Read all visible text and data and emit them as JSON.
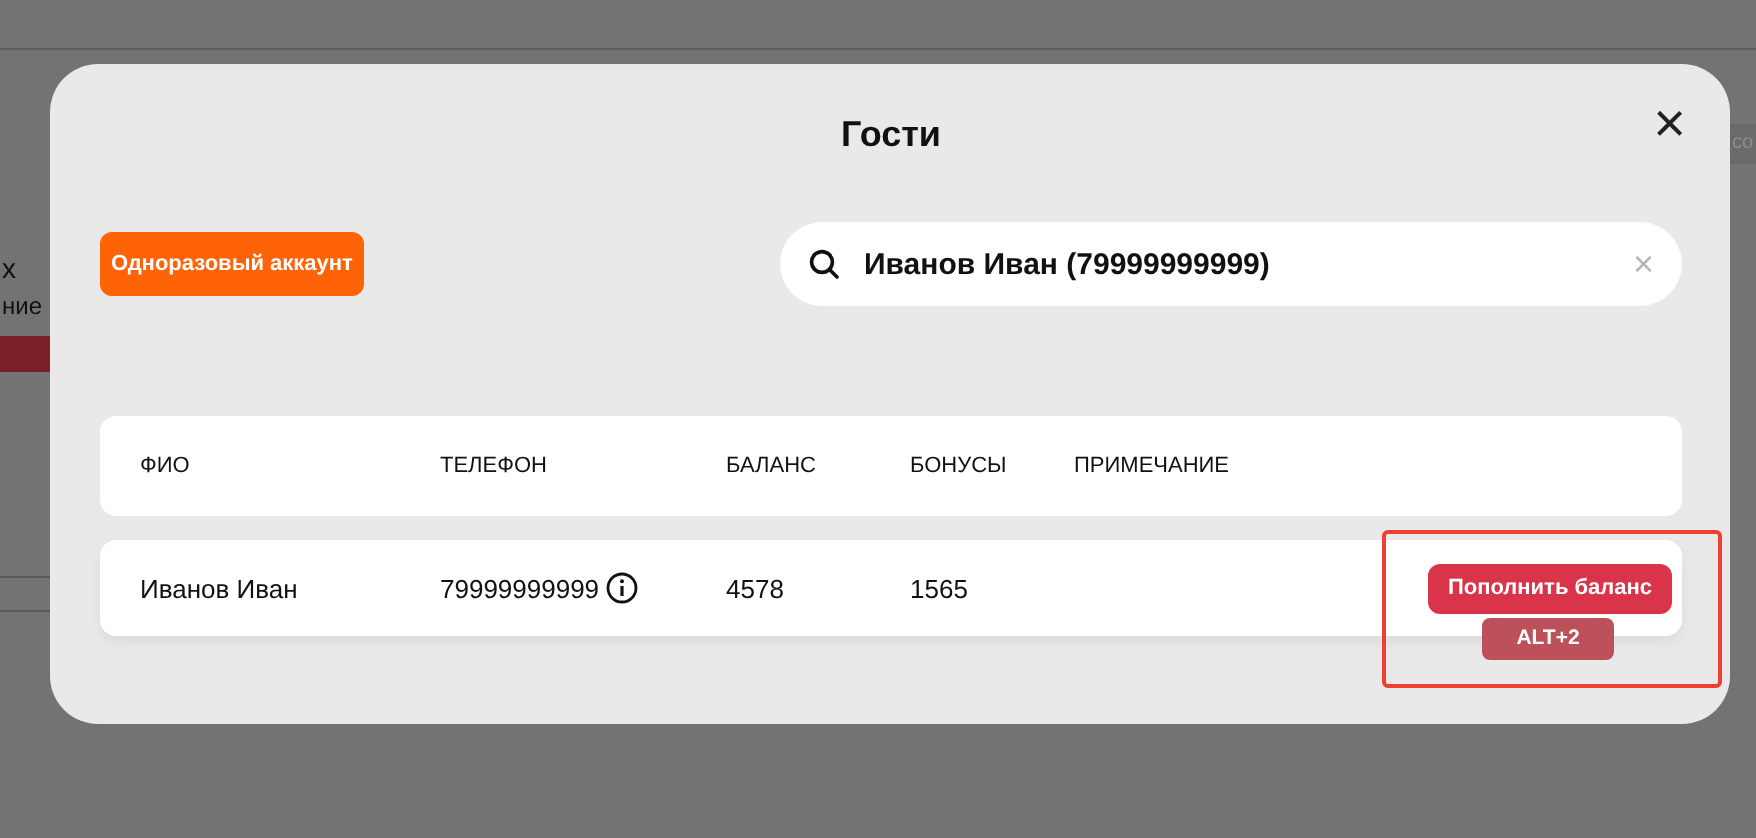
{
  "background": {
    "texts": [
      "х",
      "ние",
      "co"
    ]
  },
  "dialog": {
    "title": "Гости",
    "close": "×",
    "one_time_button": "Одноразовый аккаунт",
    "search": {
      "value": "Иванов Иван (79999999999)",
      "clear": "×"
    },
    "table": {
      "columns": [
        "ФИО",
        "ТЕЛЕФОН",
        "БАЛАНС",
        "БОНУСЫ",
        "ПРИМЕЧАНИЕ"
      ],
      "rows": [
        {
          "name": "Иванов Иван",
          "phone": "79999999999",
          "balance": "4578",
          "bonuses": "1565",
          "action": "Пополнить баланс",
          "shortcut": "ALT+2"
        }
      ]
    }
  }
}
